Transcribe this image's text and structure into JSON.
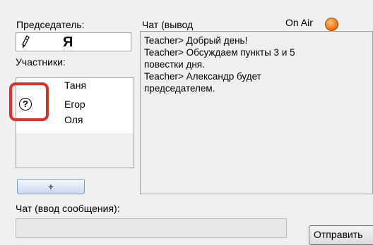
{
  "chairman": {
    "label": "Председатель:",
    "name": "Я"
  },
  "participants": {
    "label": "Участники:",
    "items": [
      "Таня",
      "Егор",
      "Оля"
    ],
    "status_icon": "question-mark-icon"
  },
  "add_button": {
    "label": "+"
  },
  "chat_output": {
    "label": "Чат (вывод",
    "messages": [
      "Teacher> Добрый день!",
      "Teacher> Обсуждаем пункты 3 и 5",
      "повестки дня.",
      "Teacher> Александр будет",
      "председателем."
    ]
  },
  "on_air": {
    "label": "On Air",
    "color": "#f07a1a"
  },
  "chat_input": {
    "label": "Чат (ввод сообщения):",
    "value": ""
  },
  "send_button": {
    "label": "Отправить"
  },
  "colors": {
    "highlight": "#e0302a"
  }
}
